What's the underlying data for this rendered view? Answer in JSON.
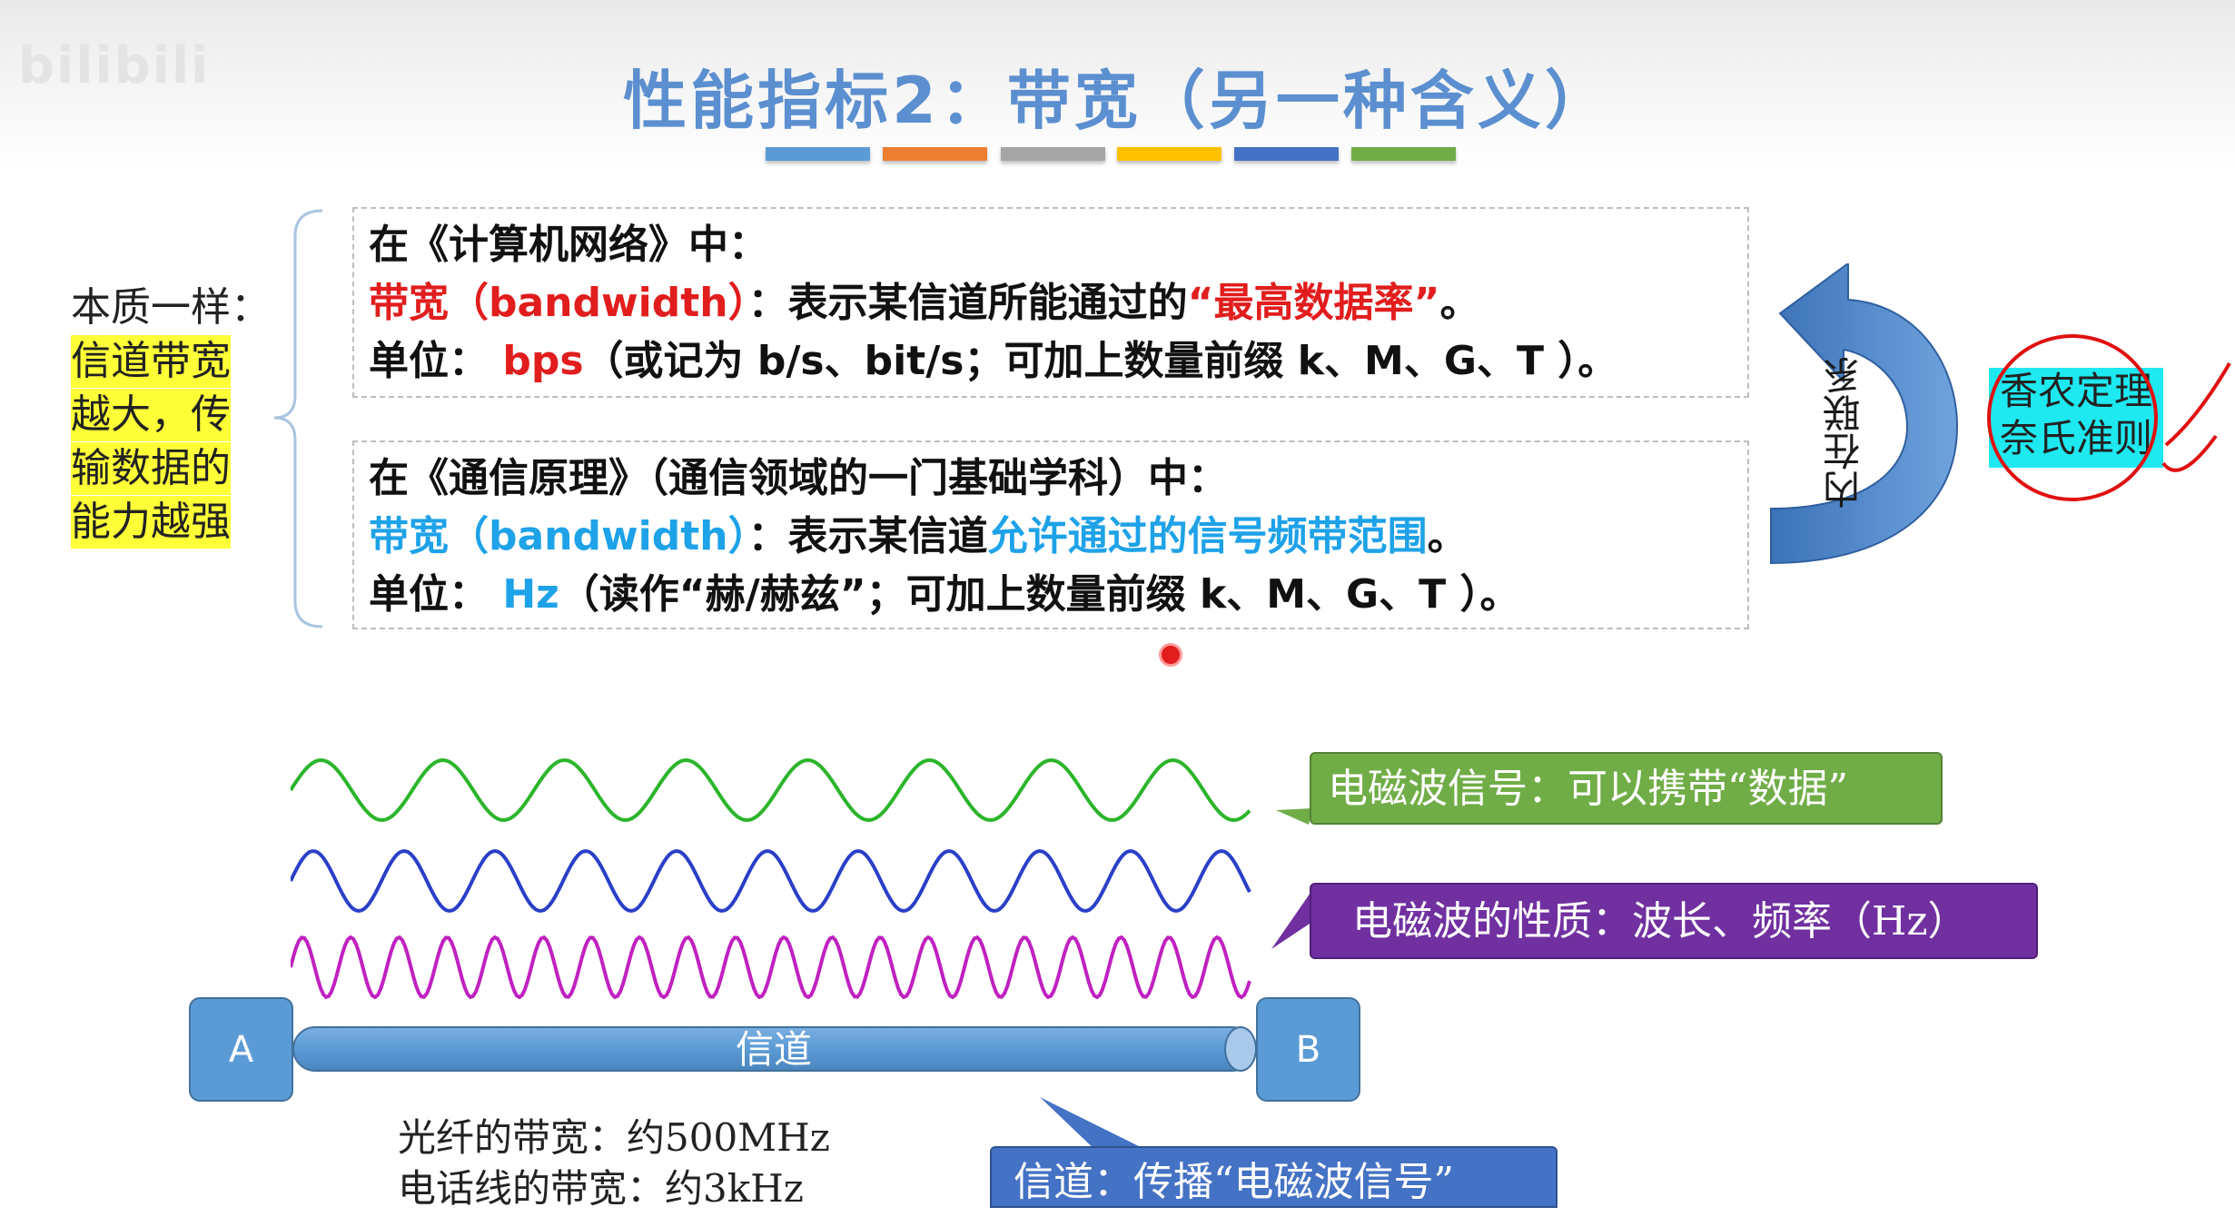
{
  "watermark": "bilibili",
  "title": "性能指标2：带宽（另一种含义）",
  "color_bars": [
    "#5b9bd5",
    "#ed7d31",
    "#a5a5a5",
    "#ffc000",
    "#4472c4",
    "#70ad47"
  ],
  "side": {
    "heading": "本质一样：",
    "highlight_lines": [
      "信道带宽",
      "越大，传",
      "输数据的",
      "能力越强"
    ]
  },
  "box1": {
    "line1": "在《计算机网络》中：",
    "term": "带宽（bandwidth）",
    "def_pre": "：表示某信道所能通过的",
    "def_hl": "“最高数据率”",
    "def_end": "。",
    "unit_label": "单位：",
    "unit_value": "bps",
    "unit_rest": "（或记为 b/s、bit/s；可加上数量前缀 k、M、G、T ）。"
  },
  "box2": {
    "line1": "在《通信原理》（通信领域的一门基础学科）中：",
    "term": "带宽（bandwidth）",
    "def_pre": "：表示某信道",
    "def_hl": "允许通过的信号频带范围",
    "def_end": "。",
    "unit_label": "单位：",
    "unit_value": "Hz",
    "unit_rest": "（读作“赫/赫兹”；可加上数量前缀 k、M、G、T ）。"
  },
  "relation_label": "内在联系",
  "theorem": {
    "line1": "香农定理",
    "line2": "奈氏准则"
  },
  "callouts": {
    "green": "电磁波信号：可以携带“数据”",
    "purple": "电磁波的性质：波长、频率（Hz）",
    "blue": "信道：传播“电磁波信号”"
  },
  "nodes": {
    "a": "A",
    "b": "B"
  },
  "channel_label": "信道",
  "fiber": {
    "line1": "光纤的带宽：约500MHz",
    "line2": "电话线的带宽：约3kHz"
  }
}
